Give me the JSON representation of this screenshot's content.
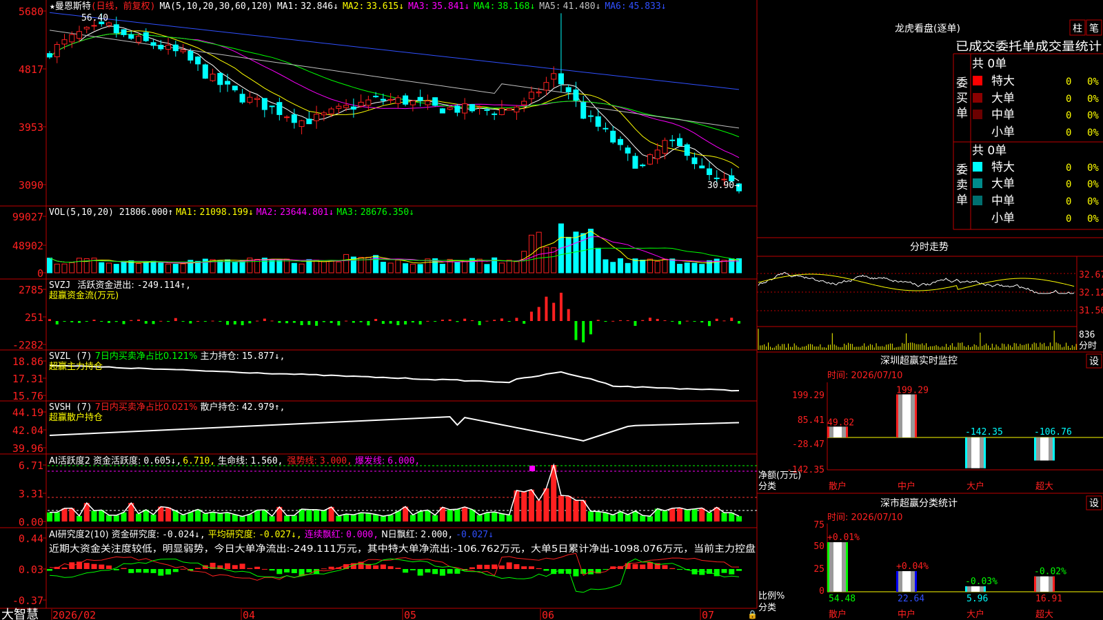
{
  "app": {
    "brand": "大智慧"
  },
  "main_chart": {
    "stock_name": "★曼恩斯特",
    "period": "(日线，前复权)",
    "ma_params": "MA(5,10,20,30,60,120)",
    "ma": [
      {
        "label": "MA1:",
        "value": "32.846↓",
        "color": "#ffffff"
      },
      {
        "label": "MA2:",
        "value": "33.615↓",
        "color": "#ffff00"
      },
      {
        "label": "MA3:",
        "value": "35.841↓",
        "color": "#ff00ff"
      },
      {
        "label": "MA4:",
        "value": "38.168↓",
        "color": "#00ff00"
      },
      {
        "label": "MA5:",
        "value": "41.480↓",
        "color": "#c0c0c0"
      },
      {
        "label": "MA6:",
        "value": "45.833↓",
        "color": "#3050ff"
      }
    ],
    "y_ticks": [
      "5680",
      "4817",
      "3953",
      "3090"
    ],
    "high_label": "56.40",
    "low_label": "30.90→",
    "ylim": [
      30.0,
      57.5
    ]
  },
  "vol_panel": {
    "title": "VOL(5,10,20)",
    "value": "21806.000↑",
    "ma": [
      {
        "label": "MA1:",
        "value": "21098.199↓",
        "color": "#ffff00"
      },
      {
        "label": "MA2:",
        "value": "23644.801↓",
        "color": "#ff00ff"
      },
      {
        "label": "MA3:",
        "value": "28676.350↓",
        "color": "#00ff00"
      }
    ],
    "y_ticks": [
      "99027",
      "48902",
      "0"
    ]
  },
  "svzj_panel": {
    "title": "SVZJ",
    "label": "活跃资金进出:",
    "value": "-249.114↑,",
    "subtitle": "超赢资金流(万元)",
    "y_ticks": [
      "2785",
      "251",
      "-2282"
    ]
  },
  "svzl_panel": {
    "title": "SVZL (7)",
    "label": "7日内买卖净占比0.121%",
    "label2": "主力持仓:",
    "value": "15.877↓,",
    "subtitle": "超赢主力持仓",
    "y_ticks": [
      "18.86",
      "17.31",
      "15.76"
    ]
  },
  "svsh_panel": {
    "title": "SVSH (7)",
    "label": "7日内买卖净占比0.021%",
    "label2": "散户持仓:",
    "value": "42.979↑,",
    "subtitle": "超赢散户持仓",
    "y_ticks": [
      "44.19",
      "42.04",
      "39.96"
    ]
  },
  "ai_active_panel": {
    "title": "AI活跃度2",
    "label": "资金活跃度:",
    "value": "0.605↓,",
    "value2": "6.710,",
    "life_label": "生命线:",
    "life_value": "1.560,",
    "strong_label": "强势线:",
    "strong_value": "3.000,",
    "burst_label": "爆发线:",
    "burst_value": "6.000,",
    "y_ticks": [
      "6.71",
      "3.31",
      "0.00"
    ]
  },
  "ai_research_panel": {
    "title": "AI研究度2(10)",
    "label": "资金研究度:",
    "value": "-0.024↓,",
    "avg_label": "平均研究度:",
    "avg_value": "-0.027↓,",
    "streak_label": "连续飘红:",
    "streak_value": "0.000,",
    "nday_label": "N日飘红:",
    "nday_value": "2.000,",
    "last_value": "-0.027↓",
    "comment": "近期大资金关注度较低，明显弱势，今日大单净流出:-249.111万元，其中特大单净流出:-106.762万元，大单5日累计净出-1098.076万元，当前主力控盘",
    "y_ticks": [
      "0.44",
      "0.03",
      "-0.37"
    ]
  },
  "x_axis": {
    "labels": [
      "2026/02",
      "04",
      "05",
      "06",
      "07"
    ]
  },
  "dragon_tiger": {
    "title": "龙虎看盘(逐单)",
    "tab_col": "柱",
    "tab_pen": "笔",
    "header": "已成交委托单成交量统计",
    "buy_side": "委买单",
    "sell_side": "委卖单",
    "buy_total": "共 0单",
    "sell_total": "共 0单",
    "rows": [
      {
        "label": "特大",
        "count": "0",
        "pct": "0%"
      },
      {
        "label": "大单",
        "count": "0",
        "pct": "0%"
      },
      {
        "label": "中单",
        "count": "0",
        "pct": "0%"
      },
      {
        "label": "小单",
        "count": "0",
        "pct": "0%"
      }
    ]
  },
  "intraday": {
    "title": "分时走势",
    "prices": [
      "32.67",
      "32.12",
      "31.56"
    ],
    "vol": "836",
    "vol_label": "分时"
  },
  "sz_monitor": {
    "title": "深圳超赢实时监控",
    "settings": "设",
    "time": "时间: 2026/07/10",
    "y_ticks": [
      "199.29",
      "85.41",
      "-28.47",
      "-142.35"
    ],
    "unit_label": "净额(万元)",
    "category_label": "分类",
    "categories": [
      "散户",
      "中户",
      "大户",
      "超大"
    ],
    "values": [
      49.82,
      199.29,
      -142.35,
      -106.76
    ],
    "value_labels": [
      "49.82",
      "199.29",
      "-142.35",
      "-106.76"
    ]
  },
  "sz_stats": {
    "title": "深市超赢分类统计",
    "settings": "设",
    "time": "时间: 2026/07/10",
    "y_ticks": [
      "75",
      "50",
      "25",
      "0"
    ],
    "ratio_label": "比例%",
    "category_label": "分类",
    "categories": [
      "散户",
      "中户",
      "大户",
      "超大"
    ],
    "values": [
      54.48,
      22.64,
      5.96,
      16.91
    ],
    "value_labels": [
      "54.48",
      "22.64",
      "5.96",
      "16.91"
    ],
    "changes": [
      "+0.01%",
      "+0.04%",
      "-0.03%",
      "-0.02%"
    ]
  },
  "colors": {
    "up": "#ff2020",
    "down": "#00ffff",
    "grid": "#c00000"
  }
}
